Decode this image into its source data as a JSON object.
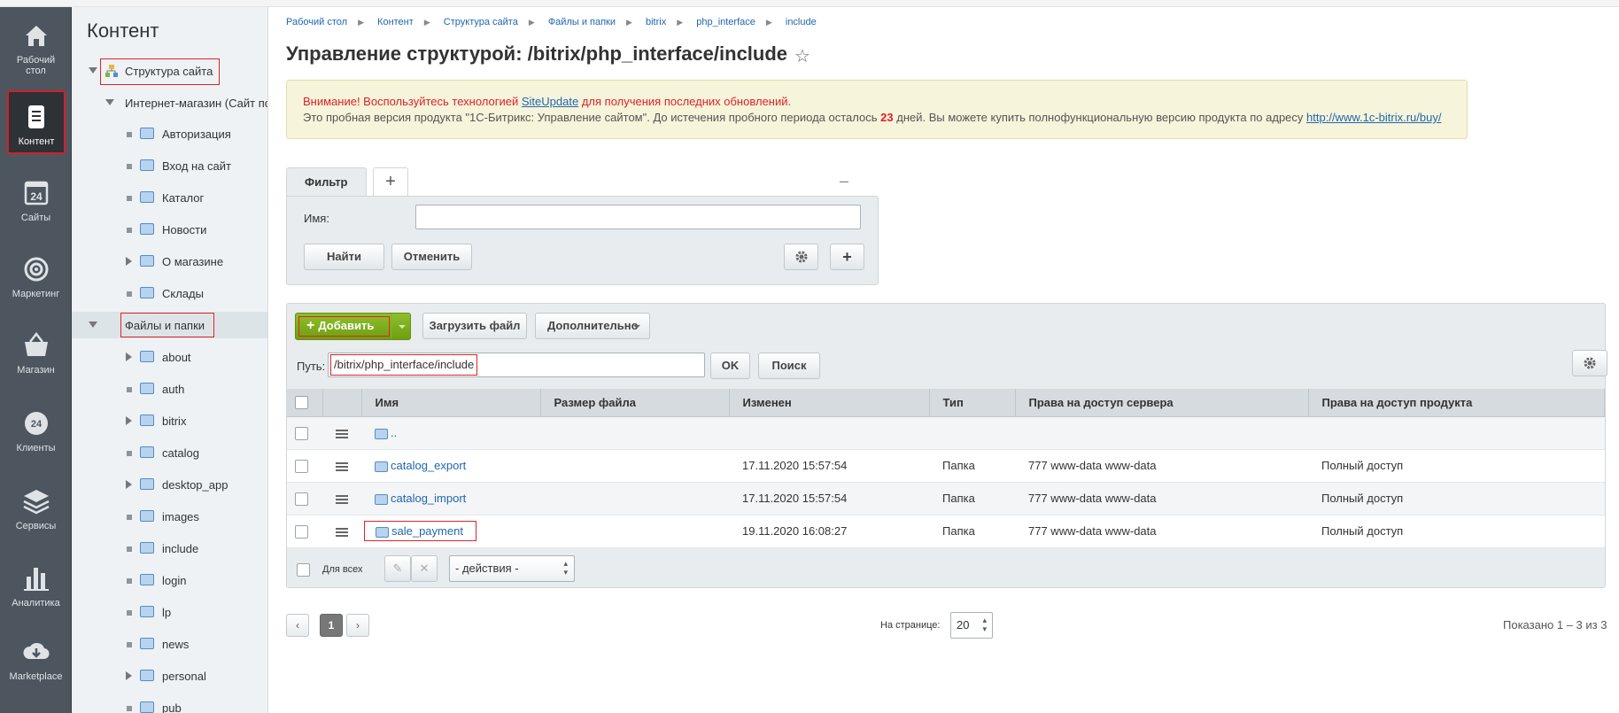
{
  "main_menu": [
    {
      "label_l1": "Рабочий",
      "label_l2": "стол",
      "icon": "home-icon"
    },
    {
      "label_l1": "Контент",
      "label_l2": "",
      "icon": "document-icon"
    },
    {
      "label_l1": "Сайты",
      "label_l2": "",
      "icon": "calendar-24-icon"
    },
    {
      "label_l1": "Маркетинг",
      "label_l2": "",
      "icon": "target-icon"
    },
    {
      "label_l1": "Магазин",
      "label_l2": "",
      "icon": "basket-icon"
    },
    {
      "label_l1": "Клиенты",
      "label_l2": "",
      "icon": "clients-24-icon"
    },
    {
      "label_l1": "Сервисы",
      "label_l2": "",
      "icon": "layers-icon"
    },
    {
      "label_l1": "Аналитика",
      "label_l2": "",
      "icon": "bar-chart-icon"
    },
    {
      "label_l1": "Marketplace",
      "label_l2": "",
      "icon": "cloud-download-icon"
    }
  ],
  "tree": {
    "title": "Контент",
    "items": [
      "Структура сайта",
      "Интернет-магазин (Сайт по умолчанию)",
      "Авторизация",
      "Вход на сайт",
      "Каталог",
      "Новости",
      "О магазине",
      "Склады",
      "Файлы и папки",
      "about",
      "auth",
      "bitrix",
      "catalog",
      "desktop_app",
      "images",
      "include",
      "login",
      "lp",
      "news",
      "personal",
      "pub"
    ]
  },
  "breadcrumbs": [
    "Рабочий стол",
    "Контент",
    "Структура сайта",
    "Файлы и папки",
    "bitrix",
    "php_interface",
    "include"
  ],
  "page_title": "Управление структурой: /bitrix/php_interface/include",
  "notice": {
    "warn_prefix": "Внимание! Воспользуйтесь технологией",
    "warn_link": "SiteUpdate",
    "warn_suffix": "для получения последних обновлений.",
    "trial_prefix": "Это пробная версия продукта \"1С-Битрикс: Управление сайтом\". До истечения пробного периода осталось",
    "days": "23",
    "trial_middle": "дней. Вы можете купить полнофункциональную версию продукта по адресу",
    "buy_link": "http://www.1c-bitrix.ru/buy/"
  },
  "filter": {
    "tab_label": "Фильтр",
    "add_tab": "+",
    "minimize": "–",
    "name_label": "Имя:",
    "name_value": "",
    "find_label": "Найти",
    "cancel_label": "Отменить"
  },
  "toolbar": {
    "add_label": "Добавить",
    "upload_label": "Загрузить файл",
    "more_label": "Дополнительно",
    "path_label": "Путь:",
    "path_value": "/bitrix/php_interface/include",
    "ok_label": "OK",
    "search_label": "Поиск"
  },
  "grid": {
    "columns": [
      "Имя",
      "Размер файла",
      "Изменен",
      "Тип",
      "Права на доступ сервера",
      "Права на доступ продукта"
    ],
    "up_label": "..",
    "rows": [
      {
        "name": "catalog_export",
        "size": "",
        "modified": "17.11.2020 15:57:54",
        "type": "Папка",
        "server_rights": "777 www-data www-data",
        "product_rights": "Полный доступ"
      },
      {
        "name": "catalog_import",
        "size": "",
        "modified": "17.11.2020 15:57:54",
        "type": "Папка",
        "server_rights": "777 www-data www-data",
        "product_rights": "Полный доступ"
      },
      {
        "name": "sale_payment",
        "size": "",
        "modified": "19.11.2020 16:08:27",
        "type": "Папка",
        "server_rights": "777 www-data www-data",
        "product_rights": "Полный доступ"
      }
    ],
    "for_all_label": "Для всех",
    "actions_value": "- действия -"
  },
  "pager": {
    "current": "1",
    "per_page_label": "На странице:",
    "per_page_value": "20",
    "shown": "Показано 1 – 3 из 3"
  },
  "colors": {
    "accent_green": "#7aac1a",
    "sidebar_dark": "#4d565f",
    "highlight_red": "#e0232b",
    "link_blue": "#2067b0"
  }
}
